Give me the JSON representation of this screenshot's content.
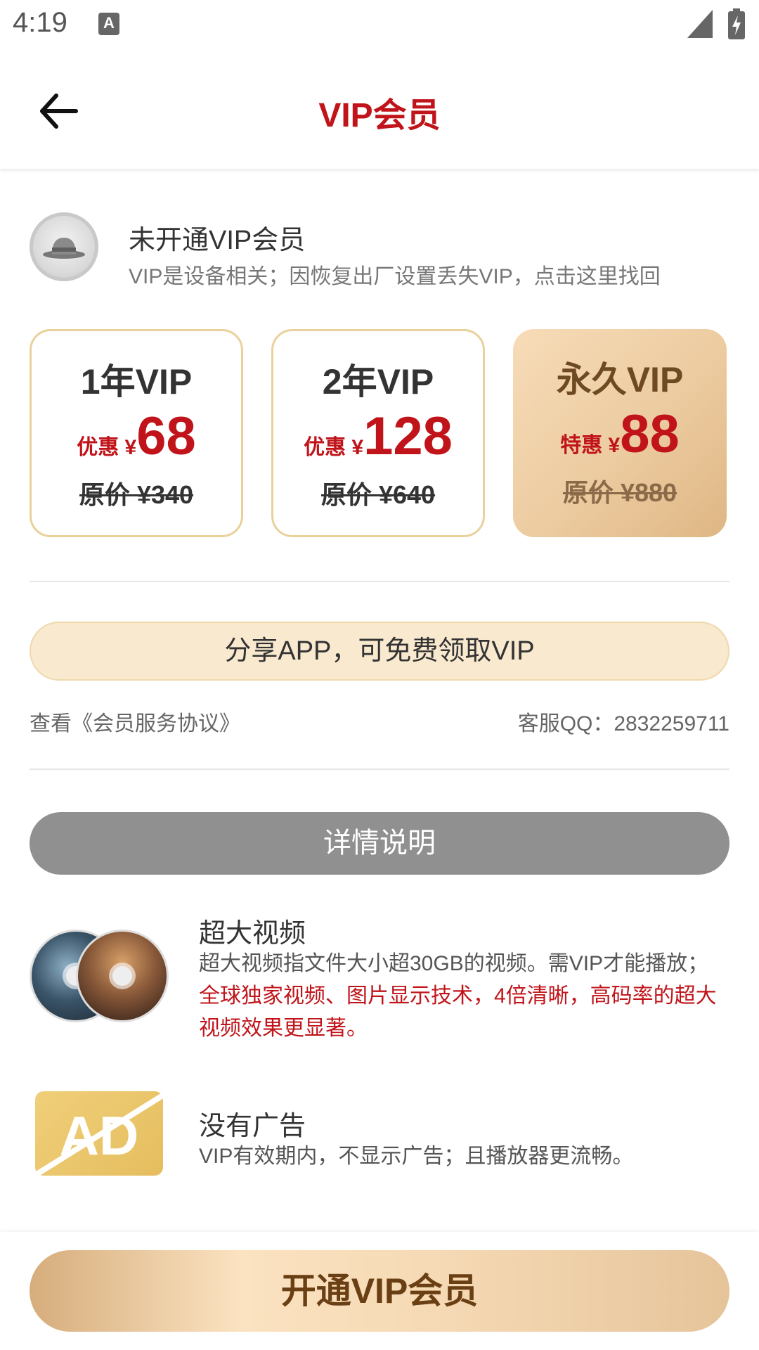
{
  "status_bar": {
    "time": "4:19",
    "notification_glyph": "A"
  },
  "header": {
    "title": "VIP会员"
  },
  "profile": {
    "title": "未开通VIP会员",
    "subtitle": "VIP是设备相关；因恢复出厂设置丢失VIP，点击这里找回"
  },
  "plans": [
    {
      "name": "1年VIP",
      "price_label": "优惠 ¥",
      "price": "68",
      "original": "原价 ¥340"
    },
    {
      "name": "2年VIP",
      "price_label": "优惠 ¥",
      "price": "128",
      "original": "原价 ¥640"
    },
    {
      "name": "永久VIP",
      "price_label": "特惠 ¥",
      "price": "88",
      "original": "原价 ¥880"
    }
  ],
  "share": {
    "label": "分享APP，可免费领取VIP"
  },
  "links": {
    "agreement": "查看《会员服务协议》",
    "service_qq": "客服QQ：2832259711"
  },
  "details": {
    "header": "详情说明",
    "features": [
      {
        "icon": "video-disc-icon",
        "title": "超大视频",
        "desc": "超大视频指文件大小超30GB的视频。需VIP才能播放；",
        "highlight": "全球独家视频、图片显示技术，4倍清晰，高码率的超大视频效果更显著。"
      },
      {
        "icon": "no-ad-icon",
        "icon_text": "AD",
        "title": "没有广告",
        "desc": "VIP有效期内，不显示广告；且播放器更流畅。"
      }
    ]
  },
  "cta": {
    "label": "开通VIP会员"
  },
  "colors": {
    "accent_red": "#c0141a",
    "gold": "#e9d19c",
    "grey_header": "#909090"
  }
}
